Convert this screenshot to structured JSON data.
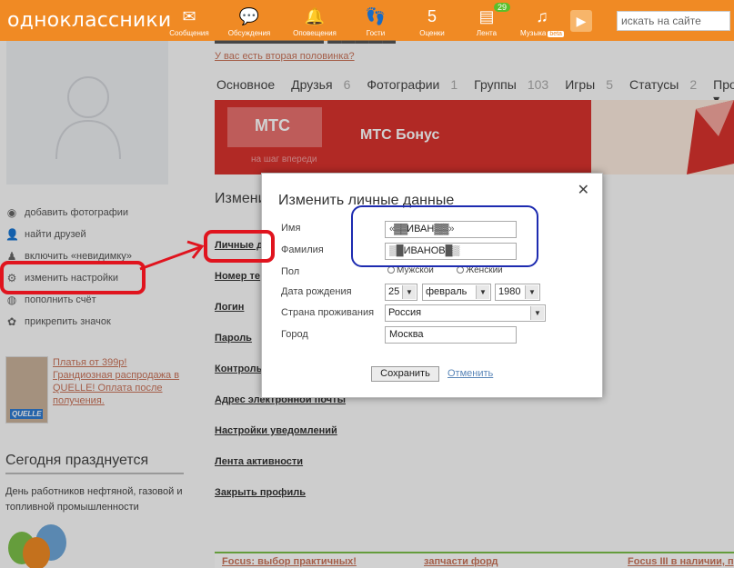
{
  "topbar": {
    "logo": "одноклассники",
    "nav": [
      {
        "label": "Сообщения",
        "icon": "envelope-icon",
        "glyph": "✉"
      },
      {
        "label": "Обсуждения",
        "icon": "chat-bubbles-icon",
        "glyph": "💬"
      },
      {
        "label": "Оповещения",
        "icon": "bell-icon",
        "glyph": "🔔"
      },
      {
        "label": "Гости",
        "icon": "footprints-icon",
        "glyph": "👣"
      },
      {
        "label": "Оценки",
        "icon": "rating-icon",
        "glyph": "5"
      },
      {
        "label": "Лента",
        "icon": "feed-icon",
        "glyph": "▤",
        "badge": "29"
      },
      {
        "label": "Музыка",
        "icon": "music-note-icon",
        "glyph": "♫",
        "badge": "beta"
      }
    ],
    "search_placeholder": "искать на сайте"
  },
  "sidebar": {
    "menu": [
      {
        "label": "добавить фотографии",
        "glyph": "◉"
      },
      {
        "label": "найти друзей",
        "glyph": "👤"
      },
      {
        "label": "включить «невидимку»",
        "glyph": "♟"
      },
      {
        "label": "изменить настройки",
        "glyph": "⚙"
      },
      {
        "label": "пополнить счёт",
        "glyph": "◍"
      },
      {
        "label": "прикрепить значок",
        "glyph": "✿"
      }
    ],
    "promo_text": "Платья от 399р! Грандиозная распродажа в QUELLE! Оплата после получения.",
    "promo_brand": "QUELLE",
    "today_title": "Сегодня празднуется",
    "holiday_text": "День работников нефтяной, газовой и топливной промышленности"
  },
  "profile": {
    "second_half_link": "У вас есть вторая половинка?",
    "tabs": [
      {
        "label": "Основное",
        "count": ""
      },
      {
        "label": "Друзья",
        "count": "6"
      },
      {
        "label": "Фотографии",
        "count": "1"
      },
      {
        "label": "Группы",
        "count": "103"
      },
      {
        "label": "Игры",
        "count": "5"
      },
      {
        "label": "Статусы",
        "count": "2"
      },
      {
        "label": "Прочее ▾",
        "count": ""
      }
    ],
    "banner_logo": "МТС",
    "banner_title": "МТС Бонус",
    "banner_sub": "на шаг впереди",
    "section_title": "Изменить",
    "links": [
      "Личные д",
      "Номер те",
      "Логин",
      "Пароль",
      "Контроль",
      "Адрес электронной почты",
      "Настройки уведомлений",
      "Лента активности",
      "Закрыть профиль"
    ]
  },
  "dialog": {
    "title": "Изменить личные данные",
    "name_label": "Имя",
    "name_value": "ИВАН",
    "surname_label": "Фамилия",
    "surname_value": "ИВАНОВ",
    "gender_label": "Пол",
    "gender_male": "Мужской",
    "gender_female": "Женский",
    "birth_label": "Дата рождения",
    "birth_day": "25",
    "birth_month": "февраль",
    "birth_year": "1980",
    "country_label": "Страна проживания",
    "country_value": "Россия",
    "city_label": "Город",
    "city_value": "Москва",
    "save": "Сохранить",
    "cancel": "Отменить"
  },
  "footer_ads": [
    "Focus: выбор практичных!",
    "запчасти форд",
    "Focus III в наличии, пр"
  ],
  "colors": {
    "brand": "#f08a24",
    "annotation_red": "#e0141e",
    "annotation_blue": "#1d2bb0"
  }
}
